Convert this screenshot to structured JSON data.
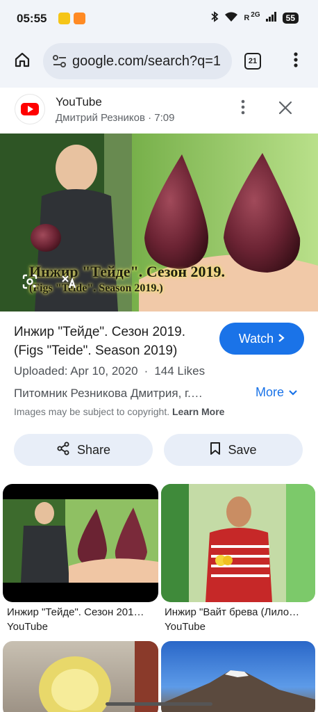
{
  "status_bar": {
    "time": "05:55",
    "signal_label": "R",
    "network_badge": "2G",
    "battery": "55"
  },
  "toolbar": {
    "url": "google.com/search?q=1",
    "tab_count": "21"
  },
  "source": {
    "name": "YouTube",
    "subtitle": "Дмитрий Резников · 7:09"
  },
  "image": {
    "overlay_line1": "Инжир \"Тейде\". Сезон 2019.",
    "overlay_line2": "(Figs \"Teide\". Season 2019.)"
  },
  "result": {
    "title": "Инжир \"Тейде\". Сезон 2019. (Figs \"Teide\". Season 2019)",
    "watch_label": "Watch",
    "uploaded": "Uploaded: Apr 10, 2020",
    "likes": "144 Likes",
    "site": "Питомник Резникова Дмитрия, г.…",
    "more_label": "More",
    "copyright_text": "Images may be subject to copyright.",
    "learn_more": "Learn More"
  },
  "actions": {
    "share_label": "Share",
    "save_label": "Save"
  },
  "related": [
    {
      "caption": "Инжир \"Тейде\". Сезон 201…",
      "source": "YouTube"
    },
    {
      "caption": "Инжир \"Вайт брева (Лило…",
      "source": "YouTube"
    }
  ],
  "colors": {
    "accent": "#1a73e8",
    "youtube_red": "#ff0000",
    "pill_bg": "#e8eef8"
  }
}
